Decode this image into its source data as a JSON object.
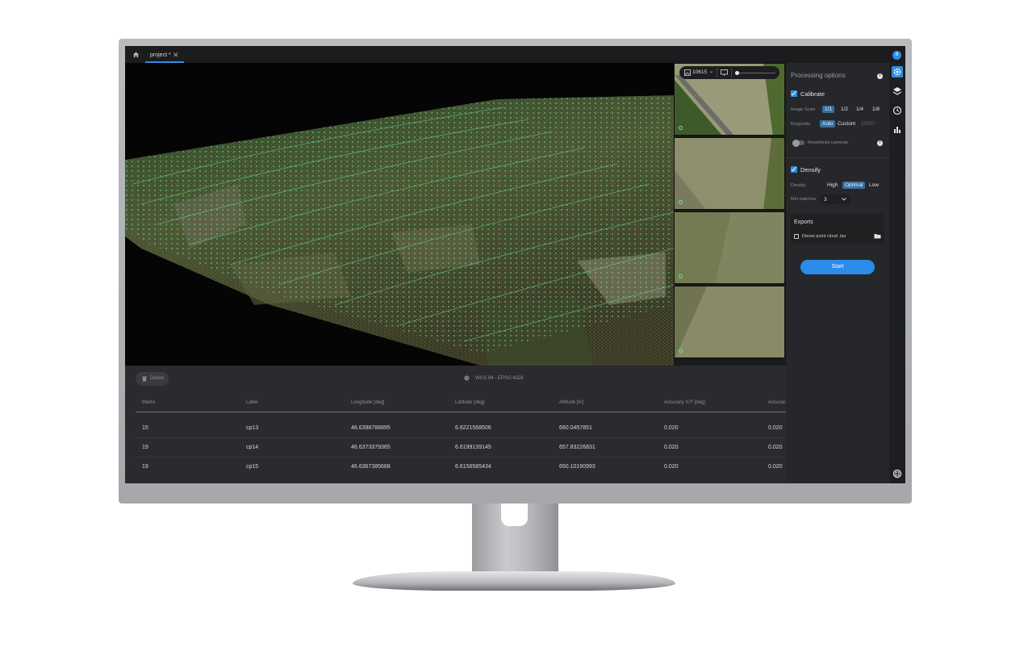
{
  "tabs": {
    "home_icon": "home-icon",
    "project_tab_label": "project *",
    "close_glyph": "✕",
    "avatar_initial": "8"
  },
  "image_toolbar": {
    "image_count": "10615",
    "chevron": "⌄"
  },
  "panel": {
    "title": "Processing options",
    "info_glyph": "i",
    "calibrate": {
      "label": "Calibrate",
      "image_scale_label": "Image Scale",
      "image_scale_options": [
        "1/1",
        "1/2",
        "1/4",
        "1/8"
      ],
      "image_scale_selected": "1/1",
      "keypoints_label": "Keypoints",
      "keypoints_options": [
        "Auto",
        "Custom"
      ],
      "keypoints_selected": "Auto",
      "keypoints_value_placeholder": "10000",
      "reoptimize_label": "Reoptimize cameras",
      "reoptimize_on": false
    },
    "densify": {
      "label": "Densify",
      "density_label": "Density",
      "density_options": [
        "High",
        "Optimal",
        "Low"
      ],
      "density_selected": "Optimal",
      "min_matches_label": "Min matches",
      "min_matches_value": "3"
    },
    "exports": {
      "title": "Exports",
      "item_label": "Dense point cloud .las"
    },
    "start_label": "Start"
  },
  "table": {
    "delete_label": "Delete",
    "crs": "WGS 84 - EPSG:4326",
    "columns": [
      "Marks",
      "Label",
      "Longitude [deg]",
      "Latitude [deg]",
      "Altitude [m]",
      "Accuracy X/Y [deg]",
      "Accurac"
    ],
    "rows": [
      [
        "15",
        "cp13",
        "46.6398786895",
        "6.6221568506",
        "660.0457851",
        "0.020",
        "0.020"
      ],
      [
        "19",
        "cp14",
        "46.6373379365",
        "6.6199139145",
        "657.83226831",
        "0.020",
        "0.020"
      ],
      [
        "19",
        "cp15",
        "46.6367385668",
        "6.6156585434",
        "650.10190993",
        "0.020",
        "0.020"
      ]
    ]
  },
  "colors": {
    "accent": "#2d8ee5",
    "point_cloud": "#5fe39a",
    "panel_bg": "#26272a"
  }
}
